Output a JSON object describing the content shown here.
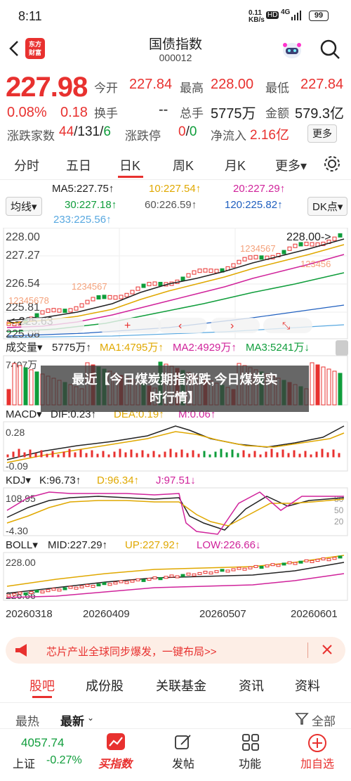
{
  "status": {
    "time": "8:11",
    "net_speed": "0.11",
    "net_unit": "KB/s",
    "hd": "HD",
    "signal": "4G",
    "battery": "99"
  },
  "header": {
    "logo_line1": "东方",
    "logo_line2": "财富",
    "title": "国债指数",
    "code": "000012"
  },
  "quote": {
    "price": "227.98",
    "change_pct": "0.08%",
    "change": "0.18",
    "open_label": "今开",
    "open": "227.84",
    "high_label": "最高",
    "high": "228.00",
    "low_label": "最低",
    "low": "227.84",
    "turnover_label": "换手",
    "turnover": "--",
    "volume_label": "总手",
    "volume": "5775万",
    "amount_label": "金额",
    "amount": "579.3亿",
    "breadth_label": "涨跌家数",
    "up_count": "44",
    "flat_count": "131",
    "down_count": "6",
    "limit_label": "涨跌停",
    "limit_up": "0",
    "limit_down": "0",
    "inflow_label": "净流入",
    "inflow": "2.16亿",
    "more": "更多"
  },
  "tabs": [
    "分时",
    "五日",
    "日K",
    "周K",
    "月K",
    "更多▾"
  ],
  "ma": {
    "select": "均线▾",
    "ma5": "MA5:227.75↑",
    "ma10": "10:227.54↑",
    "ma20": "20:227.29↑",
    "ma30": "30:227.18↑",
    "ma60": "60:226.59↑",
    "ma120": "120:225.82↑",
    "ma233": "233:225.56↑",
    "dk": "DK点▾"
  },
  "kchart": {
    "y_top": "228.00",
    "y_mid1": "227.27",
    "y_mid2": "226.54",
    "y_mid3": "225.81",
    "y_bot": "225.08",
    "low_marker": "<-225.63",
    "high_marker": "228.00->",
    "seq_left": "12345678",
    "seq_mid": "1234567",
    "seq_right1": "1234567",
    "seq_right2": "123456"
  },
  "vol": {
    "select": "成交量▾",
    "v": "5775万↑",
    "ma1": "MA1:4795万↑",
    "ma2": "MA2:4929万↑",
    "ma3": "MA3:5241万↓",
    "axis": "7407万"
  },
  "overlay": {
    "line1": "最近【今日煤炭期指涨跌,今日煤炭实",
    "line2": "时行情】"
  },
  "macd": {
    "select": "MACD▾",
    "dif": "DIF:0.23↑",
    "dea": "DEA:0.19↑",
    "m": "M:0.06↑",
    "y_top": "0.28",
    "y_bot": "-0.09"
  },
  "kdj": {
    "select": "KDJ▾",
    "k": "K:96.73↑",
    "d": "D:96.34↑",
    "j": "J:97.51↓",
    "y_top": "108.95",
    "y_bot": "-4.30",
    "r80": "80",
    "r50": "50",
    "r20": "20"
  },
  "boll": {
    "select": "BOLL▾",
    "mid": "MID:227.29↑",
    "up": "UP:227.92↑",
    "low": "LOW:226.66↓",
    "y_top": "228.00",
    "y_bot": "226.66"
  },
  "dates": [
    "20260318",
    "20260409",
    "20260507",
    "20260601"
  ],
  "banner": {
    "text": "芯片产业全球同步爆发，一键布局>>"
  },
  "subtabs": [
    "股吧",
    "成份股",
    "关联基金",
    "资讯",
    "资料"
  ],
  "filters": {
    "hot": "最热",
    "new": "最新",
    "all": "全部"
  },
  "bottom": {
    "index_value": "4057.74",
    "index_name": "上证",
    "index_change": "-0.27%",
    "buy_fund": "买指数",
    "post": "发帖",
    "func": "功能",
    "add": "加自选"
  },
  "colors": {
    "up": "#e8312f",
    "down": "#0f9d3b",
    "accent": "#e8312f"
  }
}
